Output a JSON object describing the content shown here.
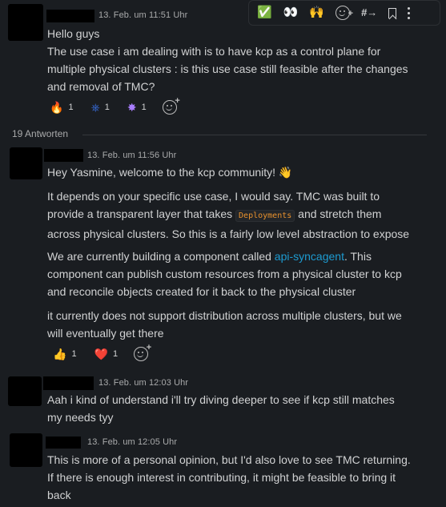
{
  "toolbar": {
    "check": "✅",
    "eyes": "👀",
    "raised_hands": "🙌",
    "thread": "#→"
  },
  "messages": [
    {
      "timestamp": "13. Feb. um 11:51 Uhr",
      "lines": [
        "Hello guys",
        "The use case i am dealing with is to have kcp as a control plane for",
        "multiple physical clusters : is this use case still feasible after the changes",
        "and removal of TMC?"
      ],
      "reactions": [
        {
          "emoji": "🔥",
          "count": "1"
        },
        {
          "emoji": "⎈",
          "count": "1"
        },
        {
          "emoji": "✸",
          "count": "1"
        }
      ]
    },
    {
      "timestamp": "13. Feb. um 11:56 Uhr",
      "greeting": "Hey Yasmine, welcome to the kcp community! 👋",
      "p1_line1": "It depends on your specific use case, I would say. TMC was built to",
      "p1_line2_a": "provide a transparent layer that takes",
      "p1_code": "Deployments",
      "p1_line2_b": "and stretch them",
      "p1_line3": "across physical clusters. So this is a fairly low level abstraction to expose",
      "p2_line1_a": "We are currently building a component called",
      "p2_link": "api-syncagent",
      "p2_line1_b": ". This",
      "p2_line2": "component can publish custom resources from a physical cluster to kcp",
      "p2_line3": "and reconcile objects created for it back to the physical cluster",
      "p3_line1": "it currently does not support distribution across multiple clusters, but we",
      "p3_line2": "will eventually get there",
      "reactions": [
        {
          "emoji": "👍",
          "count": "1"
        },
        {
          "emoji": "❤️",
          "count": "1"
        }
      ]
    },
    {
      "timestamp": "13. Feb. um 12:03 Uhr",
      "lines": [
        "Aah i kind of understand i'll try diving deeper to see if kcp still matches",
        "my needs tyy"
      ]
    },
    {
      "timestamp": "13. Feb. um 12:05 Uhr",
      "lines": [
        "This is more of a personal opinion, but I'd also love to see TMC returning.",
        "If there is enough interest in contributing, it might be feasible to bring it",
        "back"
      ]
    }
  ],
  "replies_label": "19 Antworten"
}
